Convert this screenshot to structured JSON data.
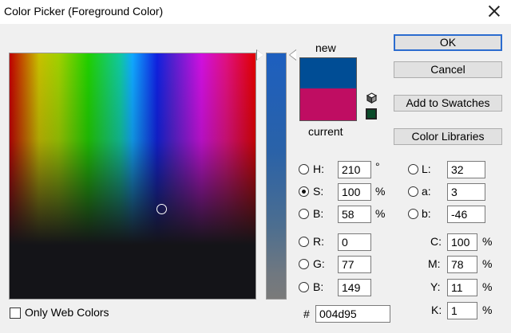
{
  "window": {
    "title": "Color Picker (Foreground Color)"
  },
  "preview": {
    "new_label": "new",
    "current_label": "current",
    "new_color": "#004d95",
    "current_color": "#bf0d62"
  },
  "buttons": {
    "ok": "OK",
    "cancel": "Cancel",
    "add_swatches": "Add to Swatches",
    "color_libraries": "Color Libraries"
  },
  "hsb": {
    "h": {
      "label": "H:",
      "value": "210",
      "unit": "°"
    },
    "s": {
      "label": "S:",
      "value": "100",
      "unit": "%"
    },
    "b": {
      "label": "B:",
      "value": "58",
      "unit": "%"
    }
  },
  "rgb": {
    "r": {
      "label": "R:",
      "value": "0"
    },
    "g": {
      "label": "G:",
      "value": "77"
    },
    "b": {
      "label": "B:",
      "value": "149"
    }
  },
  "lab": {
    "l": {
      "label": "L:",
      "value": "32"
    },
    "a": {
      "label": "a:",
      "value": "3"
    },
    "b": {
      "label": "b:",
      "value": "-46"
    }
  },
  "cmyk": {
    "c": {
      "label": "C:",
      "value": "100",
      "unit": "%"
    },
    "m": {
      "label": "M:",
      "value": "78",
      "unit": "%"
    },
    "y": {
      "label": "Y:",
      "value": "11",
      "unit": "%"
    },
    "k": {
      "label": "K:",
      "value": "1",
      "unit": "%"
    }
  },
  "hex": {
    "label": "#",
    "value": "004d95"
  },
  "options": {
    "only_web_colors": "Only Web Colors"
  }
}
